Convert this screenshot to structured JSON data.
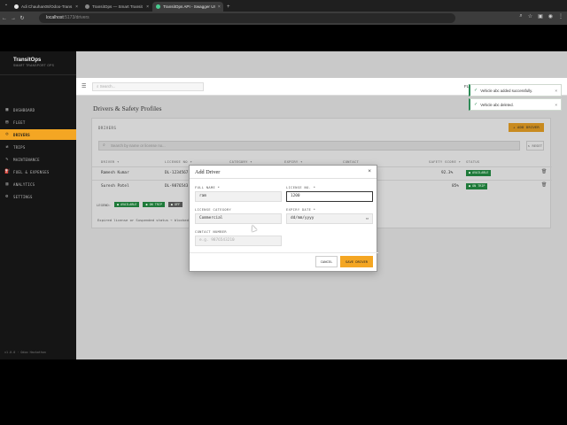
{
  "browser": {
    "tabs": [
      {
        "label": "Adi Chauhan08/Odoo-Trans"
      },
      {
        "label": "TransitOps — Smart Transit"
      },
      {
        "label": "TransitOps API - Swagger UI"
      }
    ],
    "new_tab": "+",
    "url_host": "localhost",
    "url_path": ":5173/drivers"
  },
  "sidebar": {
    "brand_title": "TransitOps",
    "brand_subtitle": "SMART TRANSPORT OPS",
    "items": [
      {
        "label": "DASHBOARD",
        "icon": "▦"
      },
      {
        "label": "FLEET",
        "icon": "▤"
      },
      {
        "label": "DRIVERS",
        "icon": "☺"
      },
      {
        "label": "TRIPS",
        "icon": "⇄"
      },
      {
        "label": "MAINTENANCE",
        "icon": "✎"
      },
      {
        "label": "FUEL & EXPENSES",
        "icon": "⛽"
      },
      {
        "label": "ANALYTICS",
        "icon": "▥"
      },
      {
        "label": "SETTINGS",
        "icon": "⚙"
      }
    ],
    "active_index": 2,
    "version": "v1.0.0 · Odoo Hackathon"
  },
  "topbar": {
    "search_placeholder": "Search...",
    "user": "FL"
  },
  "page": {
    "title": "Drivers & Safety Profiles",
    "card_title": "DRIVERS",
    "add_button": "+ ADD DRIVER",
    "filter_placeholder": "Search by name or license no...",
    "reset_button": "↻ RESET",
    "columns": [
      "DRIVER ▾",
      "LICENSE NO ▾",
      "CATEGORY ▾",
      "EXPIRY ▾",
      "CONTACT",
      "SAFETY SCORE ▾",
      "STATUS"
    ],
    "rows": [
      {
        "driver": "Ramesh Kumar",
        "license": "DL-1234567",
        "score": "92.3%",
        "status": "● AVAILABLE"
      },
      {
        "driver": "Suresh Patel",
        "license": "DL-9876543",
        "score": "85%",
        "status": "● ON TRIP"
      }
    ],
    "legend_label": "LEGEND:",
    "legend_items": [
      "● AVAILABLE",
      "● ON TRIP",
      "● OFF"
    ],
    "note": "Expired license or Suspended status → blocked fr"
  },
  "toasts": [
    {
      "text": "Vehicle abc added successfully."
    },
    {
      "text": "Vehicle abc deleted."
    }
  ],
  "modal": {
    "title": "Add Driver",
    "full_name_label": "FULL NAME *",
    "full_name_value": "ram",
    "license_label": "LICENSE NO. *",
    "license_value": "1200",
    "category_label": "LICENSE CATEGORY",
    "category_value": "Commercial",
    "expiry_label": "EXPIRY DATE *",
    "expiry_value": "dd/mm/yyyy",
    "contact_label": "CONTACT NUMBER",
    "contact_placeholder": "e.g. 9876543210",
    "cancel": "CANCEL",
    "save": "SAVE DRIVER"
  }
}
